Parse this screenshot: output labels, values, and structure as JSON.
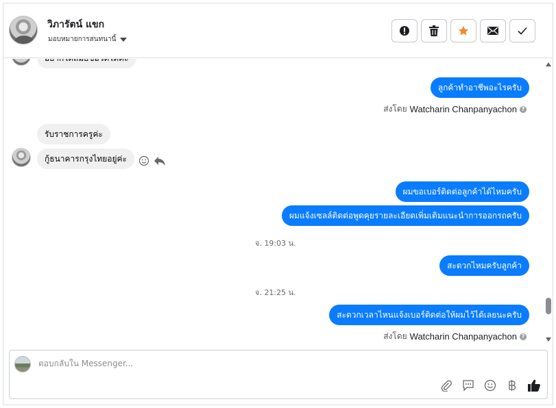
{
  "header": {
    "contact_name": "วิภารัตน์ แขก",
    "assign_label": "มอบหมายการสนทนานี้"
  },
  "messages": [
    {
      "dir": "in",
      "text": "อยากได้สมัยขอวดได้ค่ะ"
    },
    {
      "dir": "out",
      "text": "ลูกค้าทำอาชีพอะไรครับ"
    },
    {
      "dir": "in",
      "text": "รับราชการครูค่ะ"
    },
    {
      "dir": "in",
      "text": "กู้ธนาคารกรุงไทยอยู่ค่ะ"
    },
    {
      "dir": "out",
      "text": "ผมขอเบอร์ติดต่อลูกค้าได้ไหมครับ"
    },
    {
      "dir": "out",
      "text": "ผมแจ้งเซลล์ติดต่อพูดคุยรายละเอียดเพิ่มเติมแนะนำการออกรถครับ"
    },
    {
      "dir": "out",
      "text": "สะดวกไหมครับลูกค้า"
    },
    {
      "dir": "out",
      "text": "สะดวกเวลาไหนแจ้งเบอร์ติดต่อให้ผมไว้ได้เลยนะครับ"
    }
  ],
  "sent_by": {
    "prefix": "ส่งโดย",
    "name": "Watcharin Chanpanyachon"
  },
  "timestamps": [
    "จ. 19:03 น.",
    "จ. 21:25 น."
  ],
  "composer": {
    "placeholder": "ตอบกลับใน Messenger..."
  },
  "colors": {
    "outgoing_bubble": "#0a7cff",
    "incoming_bubble": "#f0f0f0",
    "star": "#f0892b"
  },
  "icons": [
    "alert-icon",
    "trash-icon",
    "star-icon",
    "mail-icon",
    "check-icon",
    "emoji-icon",
    "reply-icon",
    "paperclip-icon",
    "saved-reply-icon",
    "baht-icon",
    "thumbs-up-icon"
  ]
}
